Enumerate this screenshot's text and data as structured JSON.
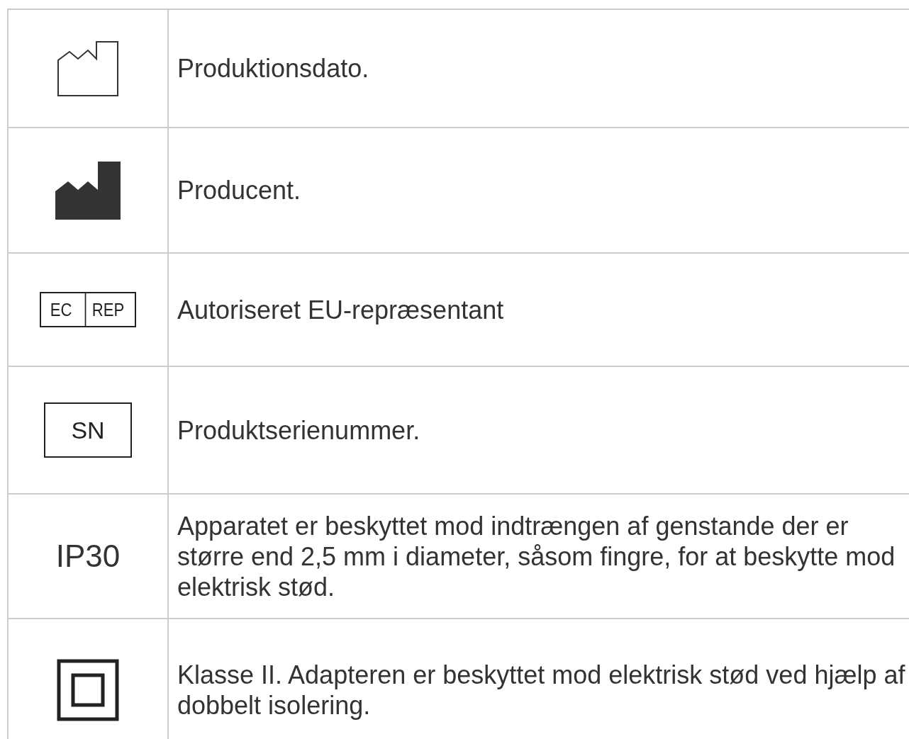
{
  "rows": [
    {
      "symbol": {
        "kind": "date"
      },
      "description": "Produktionsdato."
    },
    {
      "symbol": {
        "kind": "factory"
      },
      "description": "Producent."
    },
    {
      "symbol": {
        "kind": "ecrep",
        "texts": [
          "EC",
          "REP"
        ]
      },
      "description": "Autoriseret EU-repræsentant"
    },
    {
      "symbol": {
        "kind": "boxed",
        "texts": [
          "SN"
        ]
      },
      "description": "Produktserienummer."
    },
    {
      "symbol": {
        "kind": "plain",
        "texts": [
          "IP30"
        ]
      },
      "description": "Apparatet er beskyttet mod indtrængen af genstande der er større end 2,5 mm i diameter, såsom fingre, for at beskytte mod elektrisk stød."
    },
    {
      "symbol": {
        "kind": "class2"
      },
      "description": "Klasse II. Adapteren er beskyttet mod elektrisk stød ved hjælp af dobbelt isolering."
    }
  ]
}
